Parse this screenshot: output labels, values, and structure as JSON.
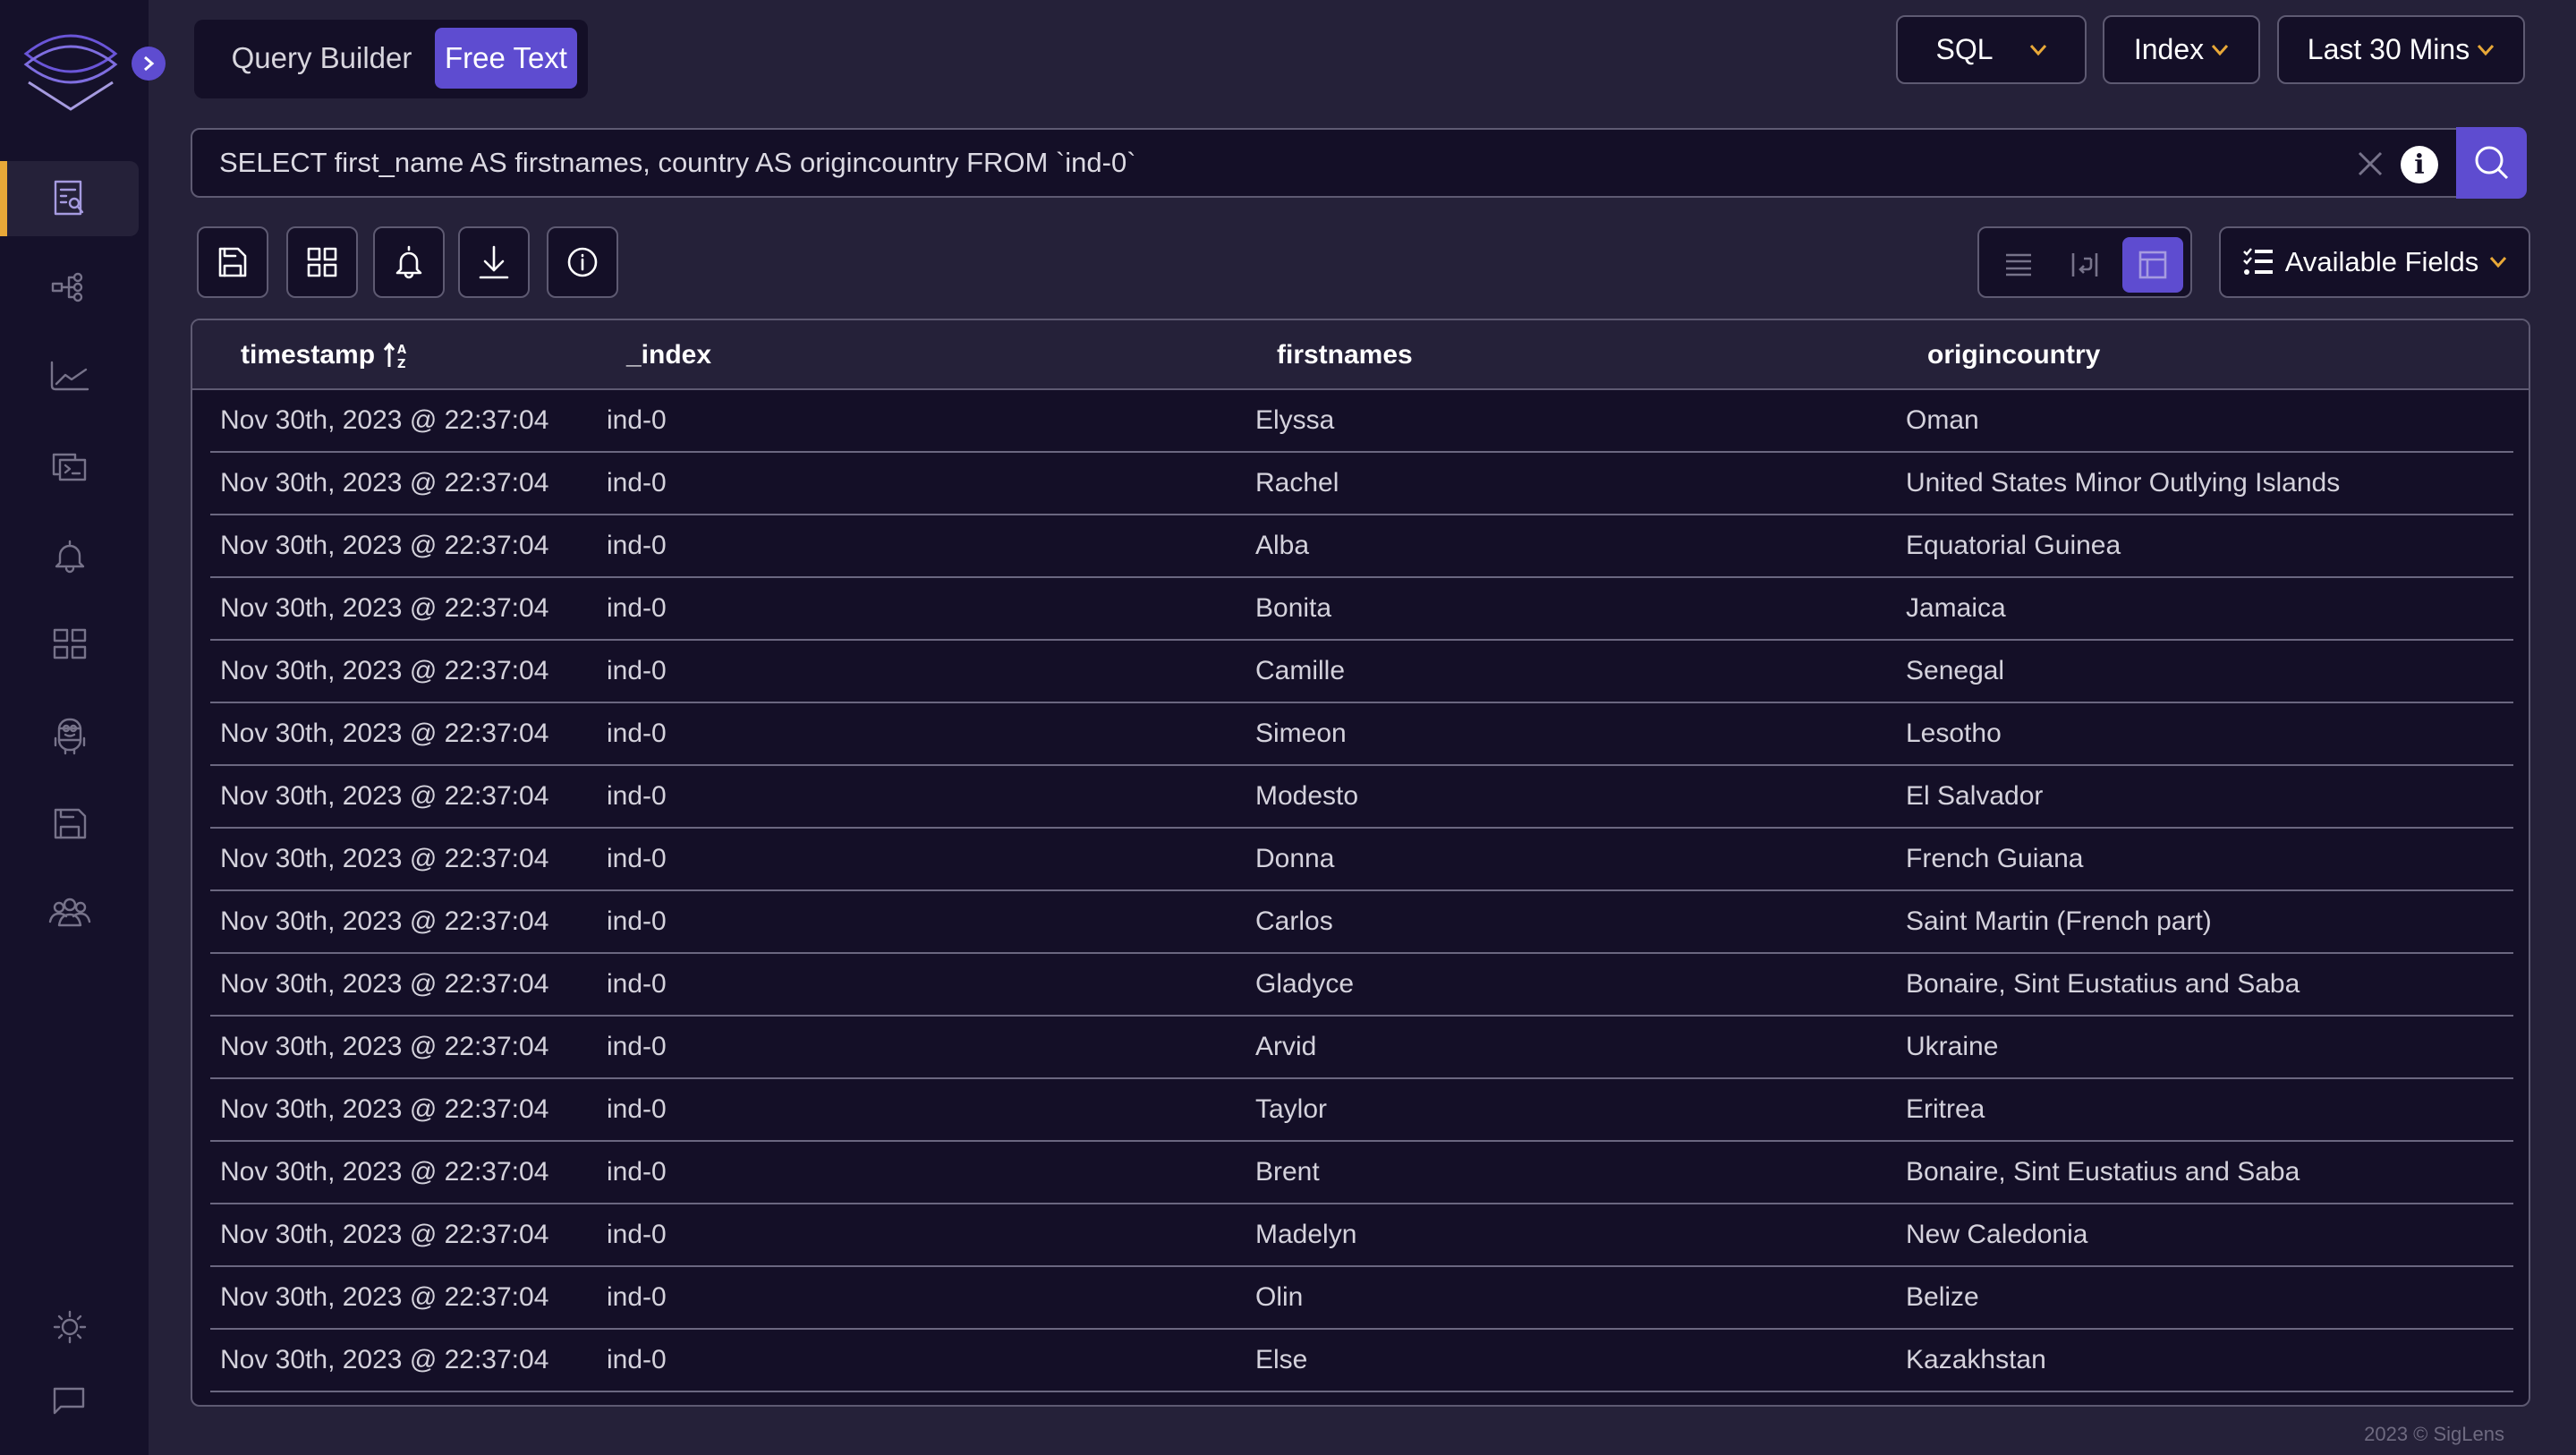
{
  "brand": "SigLens",
  "colors": {
    "accent": "#5e4cd0",
    "highlight": "#e8a838",
    "sidebar": "#15112a",
    "background": "#252139",
    "panel": "#140f27"
  },
  "sidebar": {
    "items": [
      {
        "icon": "search-logs-icon",
        "active": true
      },
      {
        "icon": "service-tree-icon"
      },
      {
        "icon": "metrics-chart-icon"
      },
      {
        "icon": "terminal-icon"
      },
      {
        "icon": "bell-icon"
      },
      {
        "icon": "dashboard-grid-icon"
      },
      {
        "icon": "minion-icon"
      },
      {
        "icon": "save-icon"
      },
      {
        "icon": "users-icon"
      }
    ],
    "bottom": [
      {
        "icon": "sun-icon"
      },
      {
        "icon": "chat-icon"
      }
    ]
  },
  "tabs": {
    "query_builder": "Query Builder",
    "free_text": "Free Text",
    "active": "Free Text"
  },
  "dropdowns": {
    "language": "SQL",
    "index": "Index",
    "time_range": "Last 30 Mins"
  },
  "search": {
    "value": "SELECT first_name AS firstnames, country AS origincountry FROM `ind-0`",
    "info_label": "i"
  },
  "toolbar": {
    "buttons": [
      "save-icon",
      "dashboard-grid-icon",
      "bell-icon",
      "download-icon",
      "info-icon"
    ]
  },
  "views": {
    "options": [
      "single-line",
      "wrap",
      "table"
    ],
    "active": "table"
  },
  "available_fields": "Available Fields",
  "table": {
    "columns": [
      "timestamp",
      "_index",
      "firstnames",
      "origincountry"
    ],
    "sort": {
      "column": "timestamp",
      "direction": "ascending"
    },
    "rows": [
      [
        "Nov 30th, 2023 @ 22:37:04",
        "ind-0",
        "Elyssa",
        "Oman"
      ],
      [
        "Nov 30th, 2023 @ 22:37:04",
        "ind-0",
        "Rachel",
        "United States Minor Outlying Islands"
      ],
      [
        "Nov 30th, 2023 @ 22:37:04",
        "ind-0",
        "Alba",
        "Equatorial Guinea"
      ],
      [
        "Nov 30th, 2023 @ 22:37:04",
        "ind-0",
        "Bonita",
        "Jamaica"
      ],
      [
        "Nov 30th, 2023 @ 22:37:04",
        "ind-0",
        "Camille",
        "Senegal"
      ],
      [
        "Nov 30th, 2023 @ 22:37:04",
        "ind-0",
        "Simeon",
        "Lesotho"
      ],
      [
        "Nov 30th, 2023 @ 22:37:04",
        "ind-0",
        "Modesto",
        "El Salvador"
      ],
      [
        "Nov 30th, 2023 @ 22:37:04",
        "ind-0",
        "Donna",
        "French Guiana"
      ],
      [
        "Nov 30th, 2023 @ 22:37:04",
        "ind-0",
        "Carlos",
        "Saint Martin (French part)"
      ],
      [
        "Nov 30th, 2023 @ 22:37:04",
        "ind-0",
        "Gladyce",
        "Bonaire, Sint Eustatius and Saba"
      ],
      [
        "Nov 30th, 2023 @ 22:37:04",
        "ind-0",
        "Arvid",
        "Ukraine"
      ],
      [
        "Nov 30th, 2023 @ 22:37:04",
        "ind-0",
        "Taylor",
        "Eritrea"
      ],
      [
        "Nov 30th, 2023 @ 22:37:04",
        "ind-0",
        "Brent",
        "Bonaire, Sint Eustatius and Saba"
      ],
      [
        "Nov 30th, 2023 @ 22:37:04",
        "ind-0",
        "Madelyn",
        "New Caledonia"
      ],
      [
        "Nov 30th, 2023 @ 22:37:04",
        "ind-0",
        "Olin",
        "Belize"
      ],
      [
        "Nov 30th, 2023 @ 22:37:04",
        "ind-0",
        "Else",
        "Kazakhstan"
      ]
    ]
  },
  "footer": "2023 © SigLens"
}
